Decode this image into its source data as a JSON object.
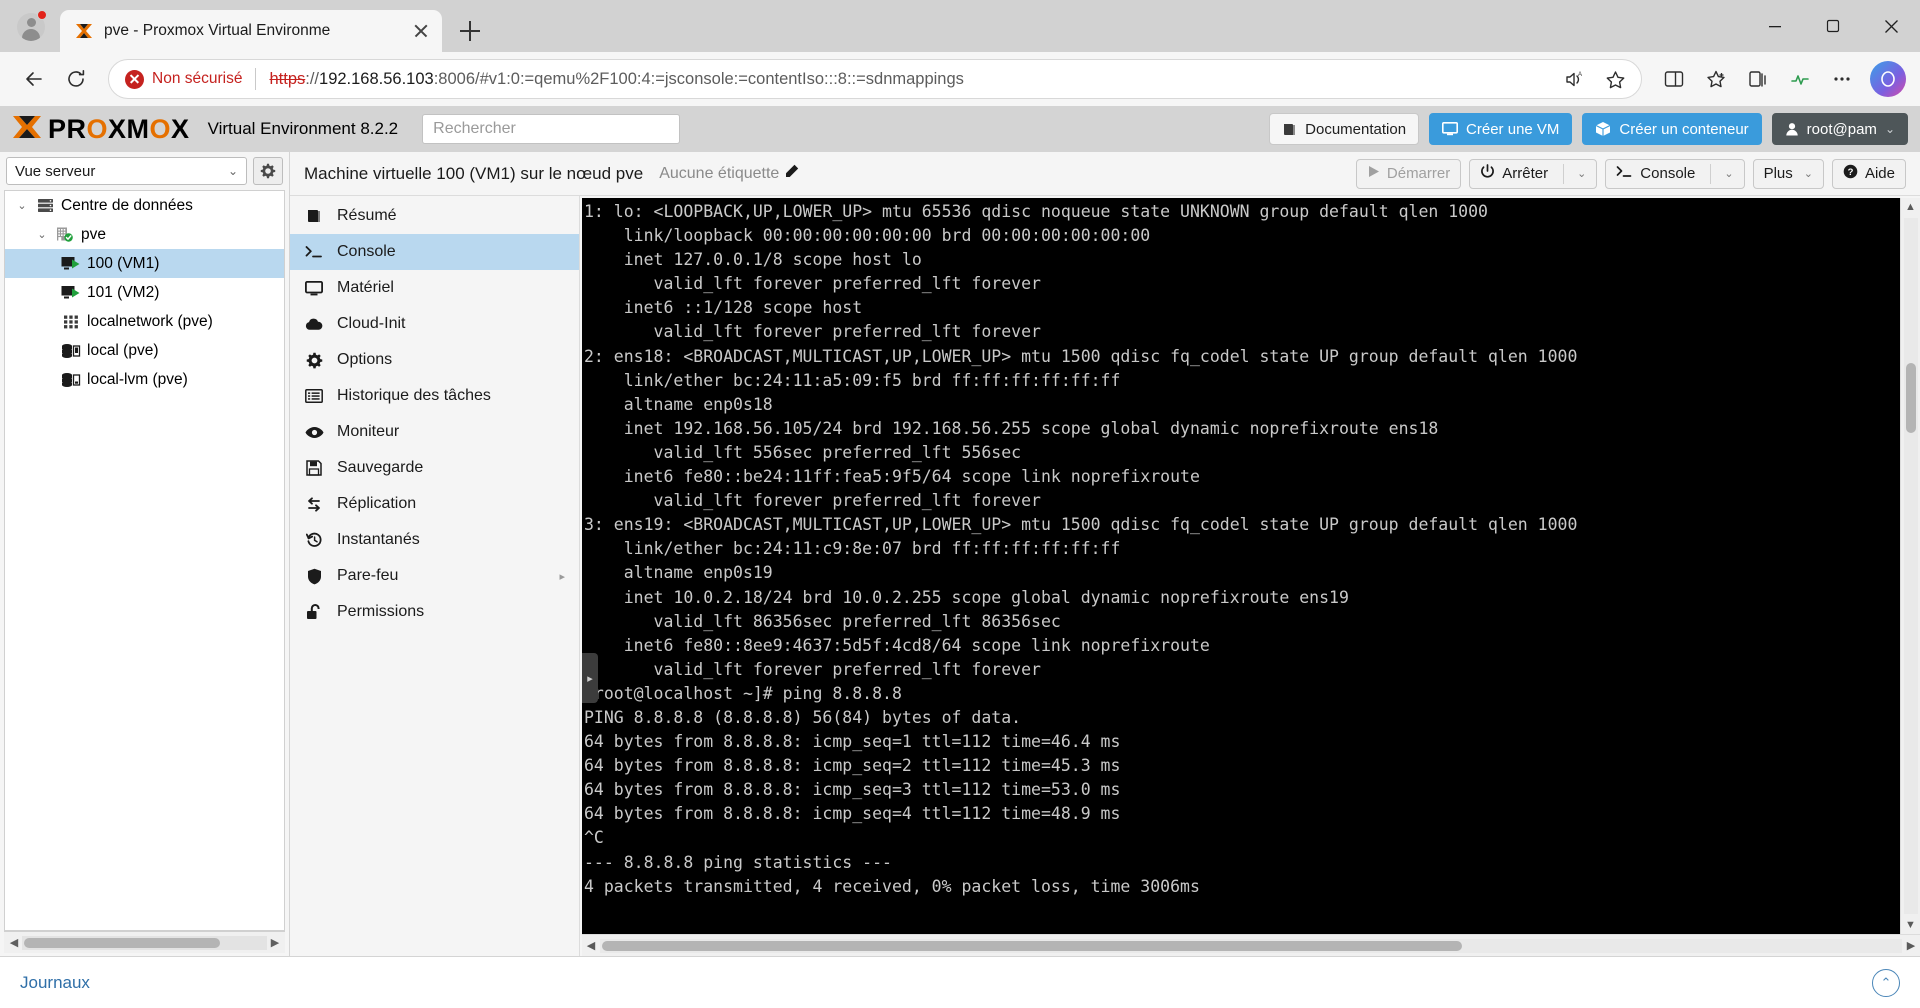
{
  "browser": {
    "tab": {
      "title": "pve - Proxmox Virtual Environme",
      "favicon": "proxmox-x-icon",
      "close": "×"
    },
    "new_tab_label": "+",
    "window_controls": {
      "minimize": "—",
      "maximize": "❐",
      "close": "✕"
    },
    "nav": {
      "back": "←",
      "reload": "⟳"
    },
    "url": {
      "security_label": "Non sécurisé",
      "scheme": "https",
      "after_scheme": "://",
      "host": "192.168.56.103",
      "rest": ":8006/#v1:0:=qemu%2F100:4:=jsconsole:=contentIso:::8::=sdnmappings",
      "full": "https://192.168.56.103:8006/#v1:0:=qemu%2F100:4:=jsconsole:=contentIso:::8::=sdnmappings"
    },
    "url_icons": [
      "read-aloud-icon",
      "favorite-star-icon"
    ],
    "toolbar_icons": [
      "split-screen-icon",
      "favorites-icon",
      "collections-icon",
      "browser-essentials-icon",
      "settings-more-icon",
      "copilot-icon"
    ]
  },
  "pve": {
    "logo": {
      "x": "X",
      "pre": "PR",
      "o1": "O",
      "mid": "XM",
      "o2": "O",
      "post": "X"
    },
    "product": "Virtual Environment 8.2.2",
    "search_placeholder": "Rechercher",
    "header_buttons": [
      {
        "label": "Documentation",
        "icon": "book-icon",
        "style": "light"
      },
      {
        "label": "Créer une VM",
        "icon": "monitor-icon",
        "style": "blue"
      },
      {
        "label": "Créer un conteneur",
        "icon": "container-box-icon",
        "style": "blue"
      },
      {
        "label": "root@pam",
        "icon": "user-icon",
        "style": "dark",
        "chevron": "⌄"
      }
    ],
    "sidebar": {
      "view_select": {
        "value": "Vue serveur",
        "chevron": "⌄"
      },
      "gear_icon": "gear-icon",
      "tree": [
        {
          "label": "Centre de données",
          "icon": "datacenter-icon",
          "indent": 0,
          "arrow": "⌄",
          "selected": false
        },
        {
          "label": "pve",
          "icon": "node-icon",
          "indent": 1,
          "arrow": "⌄",
          "selected": false
        },
        {
          "label": "100 (VM1)",
          "icon": "vm-running-icon",
          "indent": 2,
          "arrow": "",
          "selected": true
        },
        {
          "label": "101 (VM2)",
          "icon": "vm-running-icon",
          "indent": 2,
          "arrow": "",
          "selected": false
        },
        {
          "label": "localnetwork (pve)",
          "icon": "network-icon",
          "indent": 2,
          "arrow": "",
          "selected": false
        },
        {
          "label": "local (pve)",
          "icon": "storage-icon",
          "indent": 2,
          "arrow": "",
          "selected": false
        },
        {
          "label": "local-lvm (pve)",
          "icon": "storage-lvm-icon",
          "indent": 2,
          "arrow": "",
          "selected": false
        }
      ]
    },
    "vm_header": {
      "title": "Machine virtuelle 100 (VM1) sur le nœud pve",
      "tag_label": "Aucune étiquette",
      "tag_edit_icon": "pencil-icon",
      "actions": [
        {
          "label": "Démarrer",
          "icon": "play-icon",
          "disabled": true,
          "split": false
        },
        {
          "label": "Arrêter",
          "icon": "power-icon",
          "disabled": false,
          "split": true,
          "chevron": "⌄"
        },
        {
          "label": "Console",
          "icon": "terminal-prompt-icon",
          "disabled": false,
          "split": true,
          "chevron": "⌄"
        },
        {
          "label": "Plus",
          "icon": "",
          "disabled": false,
          "split": false,
          "chevron": "⌄"
        },
        {
          "label": "Aide",
          "icon": "help-icon",
          "disabled": false,
          "split": false
        }
      ]
    },
    "submenu": [
      {
        "label": "Résumé",
        "icon": "book-icon",
        "selected": false
      },
      {
        "label": "Console",
        "icon": "terminal-prompt-icon",
        "selected": true
      },
      {
        "label": "Matériel",
        "icon": "monitor-icon",
        "selected": false
      },
      {
        "label": "Cloud-Init",
        "icon": "cloud-icon",
        "selected": false
      },
      {
        "label": "Options",
        "icon": "gear-icon",
        "selected": false
      },
      {
        "label": "Historique des tâches",
        "icon": "list-icon",
        "selected": false
      },
      {
        "label": "Moniteur",
        "icon": "eye-icon",
        "selected": false
      },
      {
        "label": "Sauvegarde",
        "icon": "floppy-icon",
        "selected": false
      },
      {
        "label": "Réplication",
        "icon": "replication-icon",
        "selected": false
      },
      {
        "label": "Instantanés",
        "icon": "history-clock-icon",
        "selected": false
      },
      {
        "label": "Pare-feu",
        "icon": "shield-icon",
        "selected": false,
        "sub_arrow": "▸"
      },
      {
        "label": "Permissions",
        "icon": "unlock-icon",
        "selected": false
      }
    ],
    "console": {
      "lines": [
        "1: lo: <LOOPBACK,UP,LOWER_UP> mtu 65536 qdisc noqueue state UNKNOWN group default qlen 1000",
        "    link/loopback 00:00:00:00:00:00 brd 00:00:00:00:00:00",
        "    inet 127.0.0.1/8 scope host lo",
        "       valid_lft forever preferred_lft forever",
        "    inet6 ::1/128 scope host",
        "       valid_lft forever preferred_lft forever",
        "2: ens18: <BROADCAST,MULTICAST,UP,LOWER_UP> mtu 1500 qdisc fq_codel state UP group default qlen 1000",
        "    link/ether bc:24:11:a5:09:f5 brd ff:ff:ff:ff:ff:ff",
        "    altname enp0s18",
        "    inet 192.168.56.105/24 brd 192.168.56.255 scope global dynamic noprefixroute ens18",
        "       valid_lft 556sec preferred_lft 556sec",
        "    inet6 fe80::be24:11ff:fea5:9f5/64 scope link noprefixroute",
        "       valid_lft forever preferred_lft forever",
        "3: ens19: <BROADCAST,MULTICAST,UP,LOWER_UP> mtu 1500 qdisc fq_codel state UP group default qlen 1000",
        "    link/ether bc:24:11:c9:8e:07 brd ff:ff:ff:ff:ff:ff",
        "    altname enp0s19",
        "    inet 10.0.2.18/24 brd 10.0.2.255 scope global dynamic noprefixroute ens19",
        "       valid_lft 86356sec preferred_lft 86356sec",
        "    inet6 fe80::8ee9:4637:5d5f:4cd8/64 scope link noprefixroute",
        "       valid_lft forever preferred_lft forever",
        "[root@localhost ~]# ping 8.8.8.8",
        "PING 8.8.8.8 (8.8.8.8) 56(84) bytes of data.",
        "64 bytes from 8.8.8.8: icmp_seq=1 ttl=112 time=46.4 ms",
        "64 bytes from 8.8.8.8: icmp_seq=2 ttl=112 time=45.3 ms",
        "64 bytes from 8.8.8.8: icmp_seq=3 ttl=112 time=53.0 ms",
        "64 bytes from 8.8.8.8: icmp_seq=4 ttl=112 time=48.9 ms",
        "^C",
        "--- 8.8.8.8 ping statistics ---",
        "4 packets transmitted, 4 received, 0% packet loss, time 3006ms"
      ],
      "drag_handle": "▸"
    },
    "footer": {
      "label": "Journaux",
      "collapse_icon": "chevron-up-circle-icon"
    },
    "colors": {
      "accent_orange": "#e57000",
      "accent_blue": "#3a9bdc",
      "selection_blue": "#b9d8ef",
      "dark_button": "#4e5659",
      "insecure_red": "#c5221f",
      "terminal_bg": "#000000",
      "terminal_fg": "#c9c9c9"
    }
  }
}
